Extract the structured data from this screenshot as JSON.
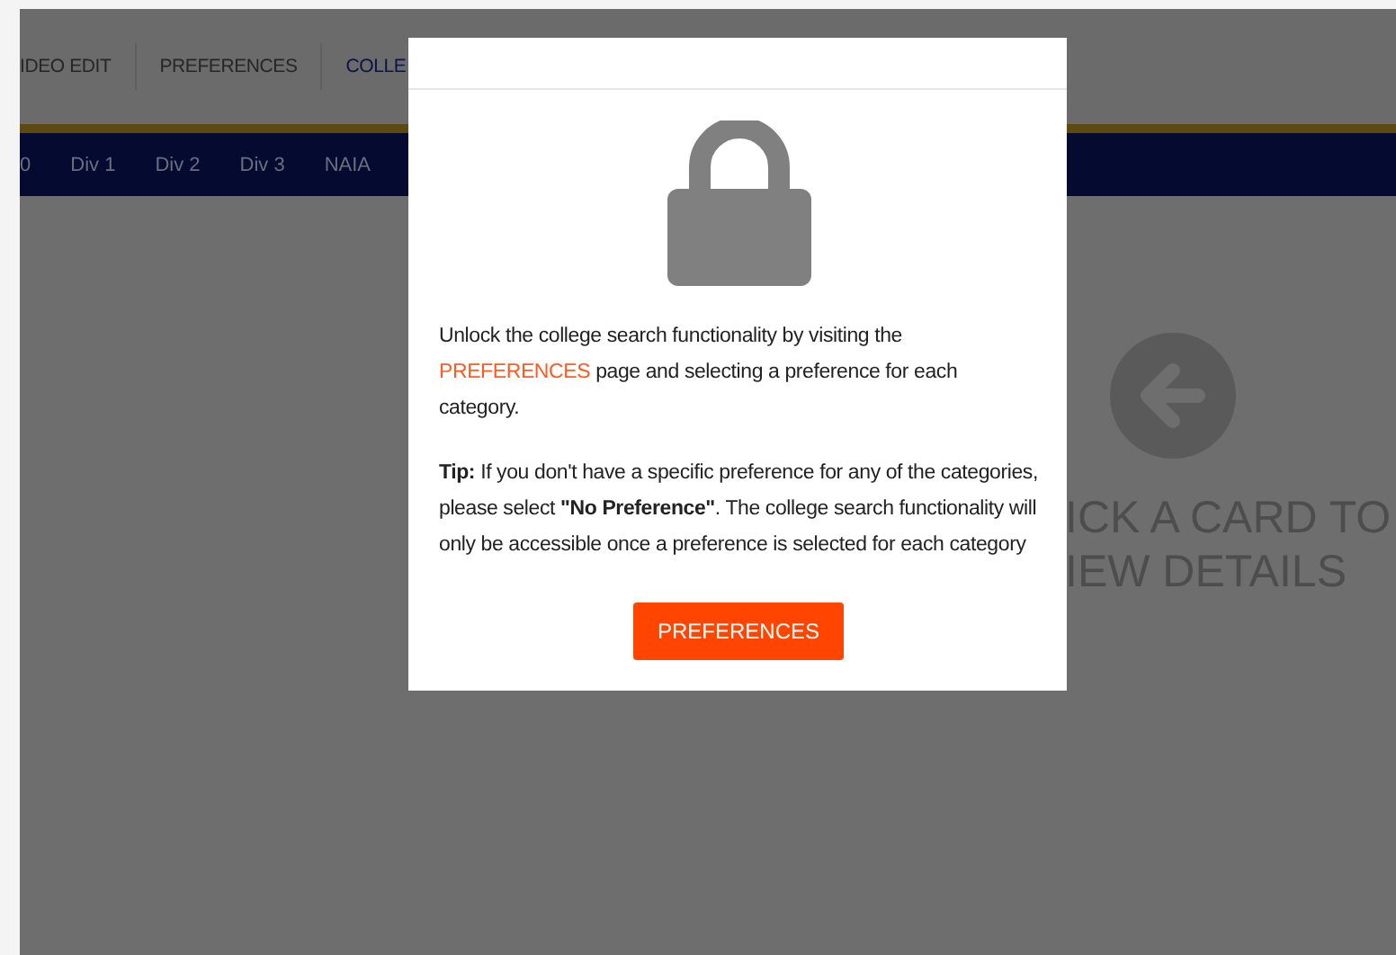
{
  "top_nav": {
    "items": [
      {
        "label": "IDEO EDIT",
        "selected": false
      },
      {
        "label": "PREFERENCES",
        "selected": false
      },
      {
        "label": "COLLE",
        "selected": true
      }
    ]
  },
  "division_tabs": [
    {
      "label": "0"
    },
    {
      "label": "Div 1"
    },
    {
      "label": "Div 2"
    },
    {
      "label": "Div 3"
    },
    {
      "label": "NAIA"
    }
  ],
  "details_panel": {
    "lines": [
      "ICK A CARD TO",
      "IEW DETAILS"
    ]
  },
  "modal": {
    "message_before": "Unlock the college search functionality by visiting the",
    "link": "PREFERENCES",
    "message_after": "page and selecting a preference for each category.",
    "tip": "**Tip:** If you don't have a specific preference for any of the categories, please select **\"No Preference\"**. The college search functionality will only be accessible once a preference is selected for each category",
    "button": "PREFERENCES"
  }
}
